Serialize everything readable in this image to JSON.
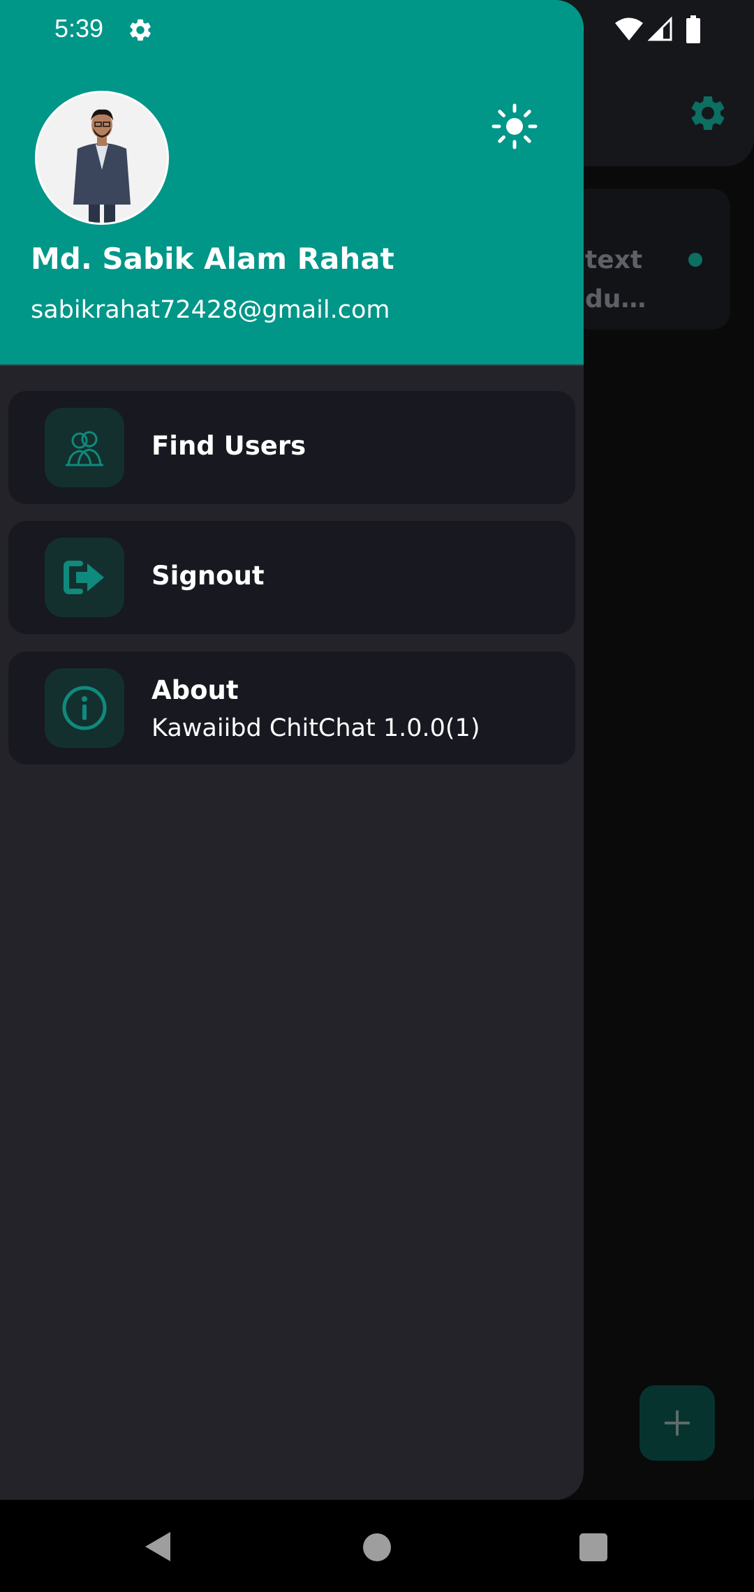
{
  "status_bar": {
    "time": "5:39",
    "icons": [
      "gear-icon",
      "wifi-icon",
      "signal-icon",
      "battery-icon"
    ]
  },
  "background_app": {
    "settings_icon": "gear-icon",
    "chat_preview_line1": "text",
    "chat_preview_line2": "du…",
    "fab_icon": "plus-icon"
  },
  "drawer": {
    "header": {
      "avatar_icon": "profile-photo",
      "theme_toggle_icon": "sun-icon",
      "user_name": "Md. Sabik Alam Rahat",
      "user_email": "sabikrahat72428@gmail.com"
    },
    "menu": [
      {
        "label": "Find Users",
        "icon": "users-icon"
      },
      {
        "label": "Signout",
        "icon": "signout-icon"
      },
      {
        "label": "About",
        "subtitle": "Kawaiibd ChitChat 1.0.0(1)",
        "icon": "info-icon"
      }
    ]
  },
  "nav_bar": {
    "buttons": [
      "back-icon",
      "home-icon",
      "recents-icon"
    ]
  },
  "colors": {
    "accent": "#009688",
    "drawer_bg": "#242329",
    "menu_item_bg": "#171820",
    "icon_box_bg": "#13302f"
  }
}
